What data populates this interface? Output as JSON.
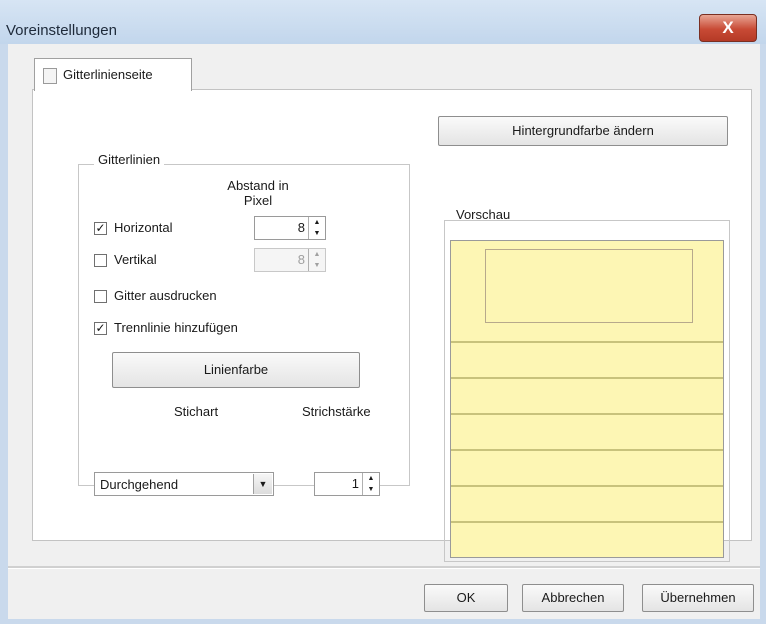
{
  "window": {
    "title": "Voreinstellungen",
    "close_glyph": "X"
  },
  "tabs": [
    {
      "label": "Gitterlinienseite",
      "icon": "page-icon"
    }
  ],
  "grid_group": {
    "title": "Gitterlinien",
    "spacing_header": "Abstand in Pixel",
    "horizontal": {
      "label": "Horizontal",
      "checked": true,
      "value": "8"
    },
    "vertical": {
      "label": "Vertikal",
      "checked": false,
      "value": "8"
    },
    "print_grid": {
      "label": "Gitter ausdrucken",
      "checked": false
    },
    "show_gridlines": {
      "label": "Trennlinie hinzufügen",
      "checked": true
    },
    "line_color_button": "Linienfarbe",
    "pen_type_label": "Stichart",
    "pen_width_label": "Strichstärke",
    "pen_type_value": "Durchgehend",
    "pen_width_value": "1"
  },
  "background_button": "Hintergrundfarbe ändern",
  "preview": {
    "title": "Vorschau",
    "background_color": "#fdf6b4",
    "line_color": "#c8c27c"
  },
  "footer": {
    "ok": "OK",
    "cancel": "Abbrechen",
    "apply": "Übernehmen"
  }
}
